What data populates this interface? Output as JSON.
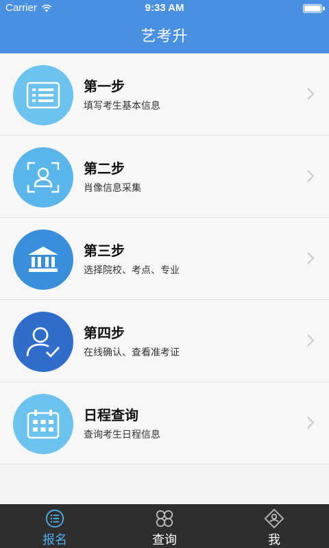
{
  "status_bar": {
    "carrier": "Carrier",
    "time": "9:33 AM"
  },
  "header": {
    "title": "艺考升"
  },
  "steps": [
    {
      "title": "第一步",
      "subtitle": "填写考生基本信息",
      "icon": "form-list-icon",
      "color": "#6cc3ef"
    },
    {
      "title": "第二步",
      "subtitle": "肖像信息采集",
      "icon": "portrait-capture-icon",
      "color": "#5ab6ea"
    },
    {
      "title": "第三步",
      "subtitle": "选择院校、考点、专业",
      "icon": "institution-icon",
      "color": "#3a8fdc"
    },
    {
      "title": "第四步",
      "subtitle": "在线确认、查看准考证",
      "icon": "user-check-icon",
      "color": "#2e6dcc"
    },
    {
      "title": "日程查询",
      "subtitle": "查询考生日程信息",
      "icon": "calendar-icon",
      "color": "#6cc3ef"
    }
  ],
  "tabs": [
    {
      "label": "报名",
      "icon": "list-icon",
      "active": true
    },
    {
      "label": "查询",
      "icon": "grid-icon",
      "active": false
    },
    {
      "label": "我",
      "icon": "profile-icon",
      "active": false
    }
  ],
  "colors": {
    "accent": "#4a90e2",
    "tab_active": "#4fb0ee",
    "tabbar_bg": "#2e2e2e"
  }
}
